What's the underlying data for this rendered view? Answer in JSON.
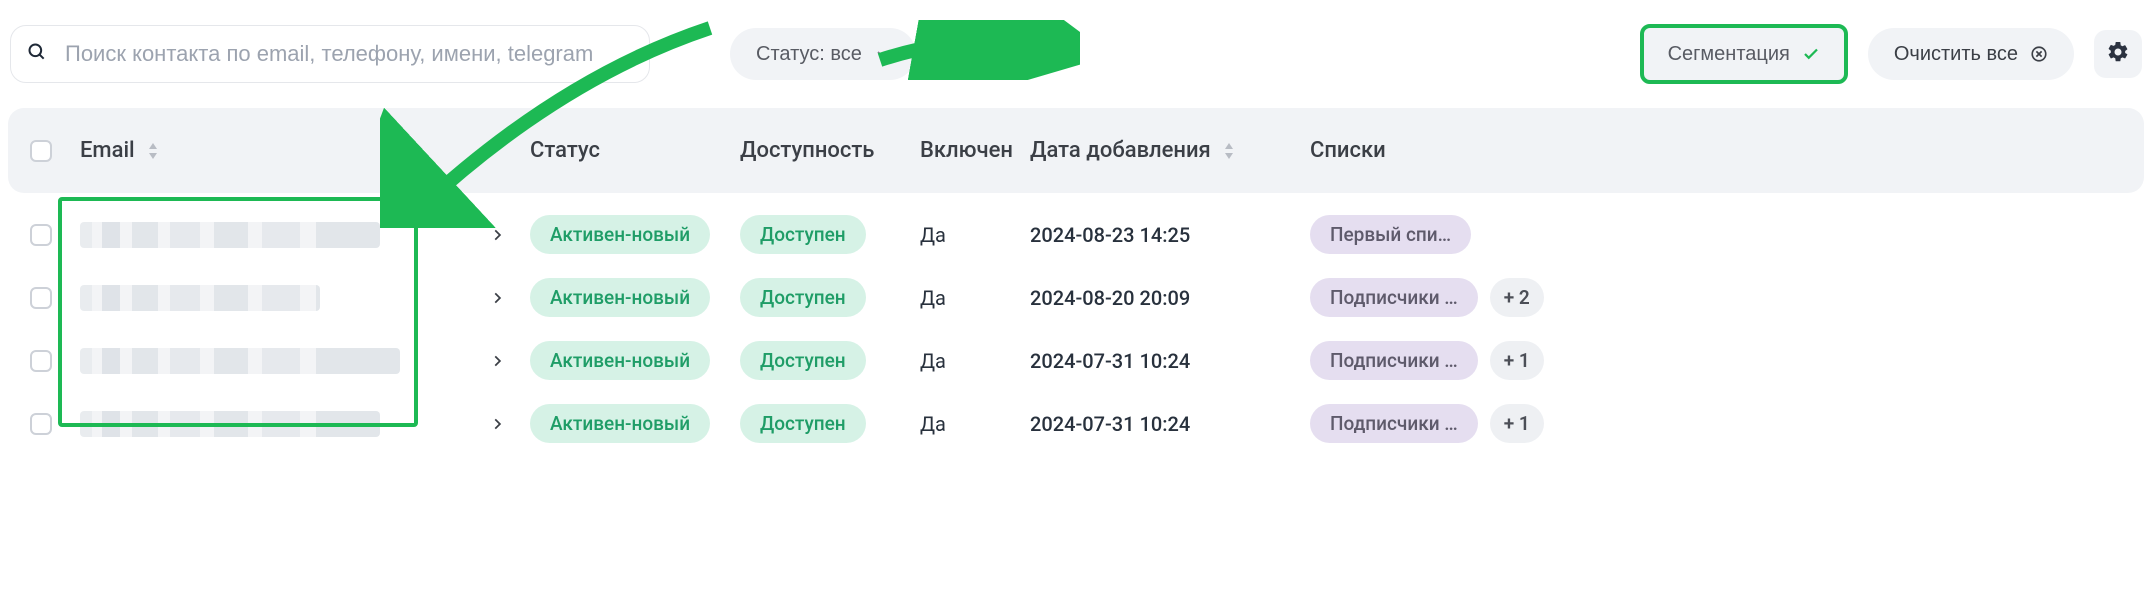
{
  "toolbar": {
    "search_placeholder": "Поиск контакта по email, телефону, имени, telegram",
    "status_filter_label": "Статус: все",
    "segment_label": "Сегментация",
    "clear_label": "Очистить все"
  },
  "columns": {
    "email": "Email",
    "status": "Статус",
    "availability": "Доступность",
    "enabled": "Включен",
    "date_added": "Дата добавления",
    "lists": "Списки"
  },
  "rows": [
    {
      "status": "Активен-новый",
      "availability": "Доступен",
      "enabled": "Да",
      "date": "2024-08-23 14:25",
      "list": "Первый спи…",
      "more": null
    },
    {
      "status": "Активен-новый",
      "availability": "Доступен",
      "enabled": "Да",
      "date": "2024-08-20 20:09",
      "list": "Подписчики …",
      "more": "+ 2"
    },
    {
      "status": "Активен-новый",
      "availability": "Доступен",
      "enabled": "Да",
      "date": "2024-07-31 10:24",
      "list": "Подписчики …",
      "more": "+ 1"
    },
    {
      "status": "Активен-новый",
      "availability": "Доступен",
      "enabled": "Да",
      "date": "2024-07-31 10:24",
      "list": "Подписчики …",
      "more": "+ 1"
    }
  ]
}
